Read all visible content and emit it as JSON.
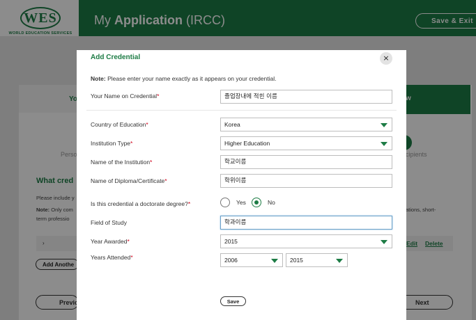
{
  "header": {
    "logo": "WES",
    "logo_subtitle": "WORLD EDUCATION SERVICES",
    "title_prefix": "My ",
    "title_bold": "Application",
    "title_suffix": " (IRCC)",
    "save_exit_label": "Save & Exit"
  },
  "background": {
    "tab_left_fragment": "Yo",
    "tab_right_fragment": "w",
    "step_left_fragment": "Perso",
    "step_right_fragment": "cipients",
    "heading_fragment": "What cred",
    "para1_fragment": "Please include y",
    "para2_label": "Note:",
    "para2_fragment": " Only com",
    "para3_fragment": "term professio",
    "para2_right": "ations, short-",
    "row_chevron": "›",
    "edit_label": "Edit",
    "delete_label": "Delete",
    "add_label": "Add Anothe",
    "previous_label": "Previo",
    "next_label": "Next"
  },
  "modal": {
    "title": "Add Credential",
    "close_icon": "×",
    "note_label": "Note:",
    "note_text": " Please enter your name exactly as it appears on your credential.",
    "name_label": "Your Name on Credential",
    "name_value": "졸업장내에 적힌 이름",
    "country_label": "Country of Education",
    "country_value": "Korea",
    "institution_type_label": "Institution Type",
    "institution_type_value": "Higher Education",
    "institution_name_label": "Name of the Institution",
    "institution_name_value": "학교이름",
    "diploma_label": "Name of Diploma/Certificate",
    "diploma_value": "학위이름",
    "doctorate_label": "Is this credential a doctorate degree?",
    "yes_label": "Yes",
    "no_label": "No",
    "doctorate_selected": "No",
    "field_of_study_label": "Field of Study",
    "field_of_study_value": "학과이름",
    "year_awarded_label": "Year Awarded",
    "year_awarded_value": "2015",
    "years_attended_label": "Years Attended",
    "years_attended_from": "2006",
    "years_attended_to": "2015",
    "save_label": "Save",
    "required_mark": "*"
  },
  "colors": {
    "brand_green": "#1d7c45",
    "required_red": "#d0021b"
  }
}
